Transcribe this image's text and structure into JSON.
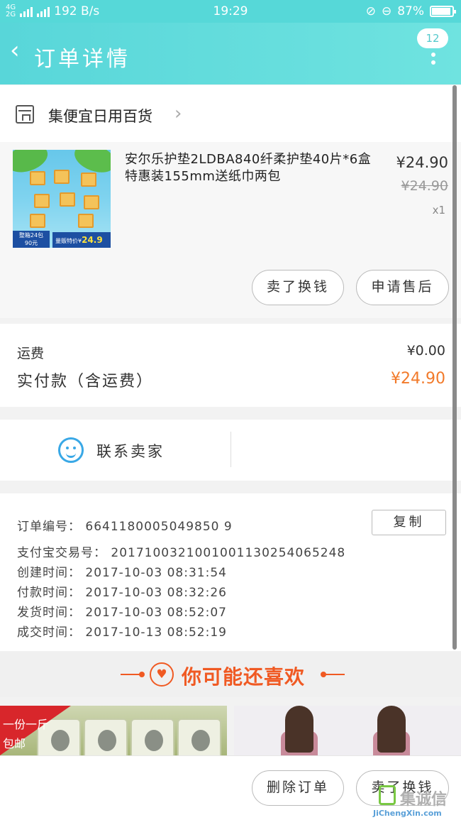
{
  "status_bar": {
    "net_top": "4G",
    "net_bottom": "2G",
    "speed": "192 B/s",
    "time": "19:29",
    "battery": "87%"
  },
  "header": {
    "back_glyph": "‹",
    "title": "订单详情",
    "message_count": "12"
  },
  "store": {
    "name": "集便宜日用百货",
    "chevron": "›"
  },
  "product": {
    "title": "安尔乐护垫2LDBA840纤柔护垫40片*6盒特惠装155mm送纸巾两包",
    "price": "¥24.90",
    "original_price": "¥24.90",
    "quantity": "x1",
    "image_badge_left": "整箱24包\n90元",
    "image_badge_right_text": "量贩特价¥",
    "image_badge_right_price": "24.9"
  },
  "actions": {
    "sell_trade": "卖了换钱",
    "after_sale": "申请售后"
  },
  "costs": {
    "shipping_label": "运费",
    "shipping_value": "¥0.00",
    "payable_label": "实付款（含运费）",
    "payable_value": "¥24.90"
  },
  "contact": {
    "label": "联系卖家"
  },
  "order_info": {
    "order_no": "订单编号：   6641180005049850 9",
    "copy_label": "复制",
    "alipay_no": "支付宝交易号：  2017100321001001130254065248",
    "created": "创建时间：  2017-10-03 08:31:54",
    "paid": "付款时间：  2017-10-03 08:32:26",
    "shipped": "发货时间：  2017-10-03 08:52:07",
    "completed": "成交时间：  2017-10-13 08:52:19"
  },
  "recommend": {
    "heading": "你可能还喜欢",
    "ribbon_line1": "一份一斤",
    "ribbon_line2": "包邮"
  },
  "bottom_actions": {
    "delete_order": "删除订单",
    "sell_trade": "卖了换钱"
  },
  "watermark": {
    "text": "集诚信",
    "sub": "JiChengXin.com"
  },
  "colors": {
    "header": "#56d8d8",
    "accent_orange": "#f05a23",
    "price_orange": "#f27a2a",
    "chat_blue": "#39a8e6"
  }
}
